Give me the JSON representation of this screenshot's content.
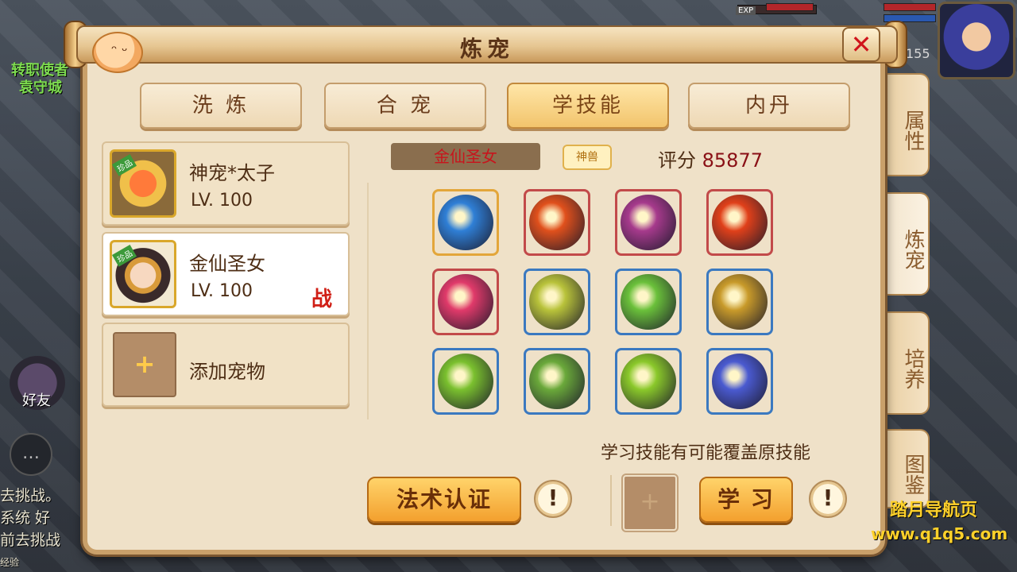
{
  "background": {
    "map_title_1": "转职使者",
    "map_title_2": "袁守城",
    "level_number": "155",
    "exp_tag": "EXP",
    "friend_label": "好友",
    "chat_lines": [
      "去挑战。",
      "系统 好",
      "前去挑战",
      "经验"
    ]
  },
  "panel": {
    "title": "炼宠",
    "close_symbol": "✕"
  },
  "top_tabs": [
    {
      "label": "洗 炼",
      "active": false
    },
    {
      "label": "合 宠",
      "active": false
    },
    {
      "label": "学技能",
      "active": true
    },
    {
      "label": "内丹",
      "active": false
    }
  ],
  "side_tabs": [
    {
      "label": "属性",
      "active": false
    },
    {
      "label": "炼宠",
      "active": true
    },
    {
      "label": "培养",
      "active": false
    },
    {
      "label": "图鉴",
      "active": false
    }
  ],
  "pets": [
    {
      "name": "神宠*太子",
      "level": "LV. 100",
      "rare_tag": "珍品",
      "battle_mark": ""
    },
    {
      "name": "金仙圣女",
      "level": "LV. 100",
      "rare_tag": "珍品",
      "battle_mark": "战"
    }
  ],
  "add_pet": {
    "label": "添加宠物",
    "symbol": "+"
  },
  "selected_pet": {
    "name": "金仙圣女",
    "badge": "神兽",
    "score_label": "评分",
    "score_value": "85877"
  },
  "skills": [
    {
      "icon": "eye-orb-icon",
      "frame": "gold",
      "color": "#2f7fd6"
    },
    {
      "icon": "lightning-burst-icon",
      "frame": "red",
      "color": "#e0501c"
    },
    {
      "icon": "feather-wing-icon",
      "frame": "red",
      "color": "#a63a8c"
    },
    {
      "icon": "fire-spiral-icon",
      "frame": "red",
      "color": "#e0401a"
    },
    {
      "icon": "pink-slash-icon",
      "frame": "red",
      "color": "#e03a6a"
    },
    {
      "icon": "golden-hammer-icon",
      "frame": "blue",
      "color": "#b8c23a"
    },
    {
      "icon": "green-blade-icon",
      "frame": "blue",
      "color": "#6ac03a"
    },
    {
      "icon": "bull-head-icon",
      "frame": "blue",
      "color": "#c89a2a"
    },
    {
      "icon": "green-streak-icon",
      "frame": "blue",
      "color": "#7ac02e"
    },
    {
      "icon": "monkey-warrior-icon",
      "frame": "blue",
      "color": "#6aa83a"
    },
    {
      "icon": "green-lightning-icon",
      "frame": "blue",
      "color": "#8ac82a"
    },
    {
      "icon": "blue-wing-icon",
      "frame": "blue",
      "color": "#4a5ad0"
    }
  ],
  "notice": "学习技能有可能覆盖原技能",
  "buttons": {
    "spell_certify": "法术认证",
    "learn": "学 习",
    "help_symbol": "!",
    "material_symbol": "+"
  },
  "watermark": {
    "line1": "踏月导航页",
    "line2": "www.q1q5.com"
  }
}
